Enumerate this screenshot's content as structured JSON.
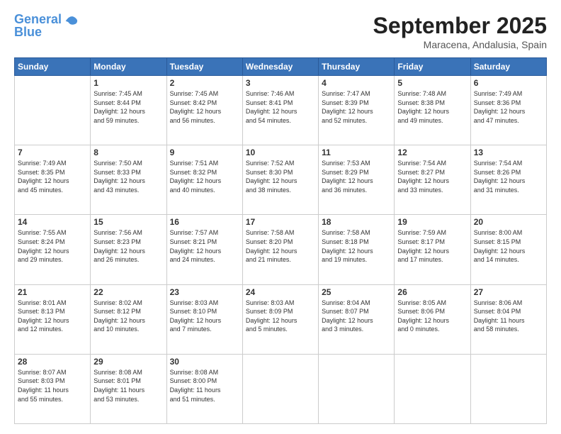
{
  "header": {
    "logo_line1": "General",
    "logo_line2": "Blue",
    "month": "September 2025",
    "location": "Maracena, Andalusia, Spain"
  },
  "weekdays": [
    "Sunday",
    "Monday",
    "Tuesday",
    "Wednesday",
    "Thursday",
    "Friday",
    "Saturday"
  ],
  "weeks": [
    [
      {
        "day": "",
        "info": ""
      },
      {
        "day": "1",
        "info": "Sunrise: 7:45 AM\nSunset: 8:44 PM\nDaylight: 12 hours\nand 59 minutes."
      },
      {
        "day": "2",
        "info": "Sunrise: 7:45 AM\nSunset: 8:42 PM\nDaylight: 12 hours\nand 56 minutes."
      },
      {
        "day": "3",
        "info": "Sunrise: 7:46 AM\nSunset: 8:41 PM\nDaylight: 12 hours\nand 54 minutes."
      },
      {
        "day": "4",
        "info": "Sunrise: 7:47 AM\nSunset: 8:39 PM\nDaylight: 12 hours\nand 52 minutes."
      },
      {
        "day": "5",
        "info": "Sunrise: 7:48 AM\nSunset: 8:38 PM\nDaylight: 12 hours\nand 49 minutes."
      },
      {
        "day": "6",
        "info": "Sunrise: 7:49 AM\nSunset: 8:36 PM\nDaylight: 12 hours\nand 47 minutes."
      }
    ],
    [
      {
        "day": "7",
        "info": "Sunrise: 7:49 AM\nSunset: 8:35 PM\nDaylight: 12 hours\nand 45 minutes."
      },
      {
        "day": "8",
        "info": "Sunrise: 7:50 AM\nSunset: 8:33 PM\nDaylight: 12 hours\nand 43 minutes."
      },
      {
        "day": "9",
        "info": "Sunrise: 7:51 AM\nSunset: 8:32 PM\nDaylight: 12 hours\nand 40 minutes."
      },
      {
        "day": "10",
        "info": "Sunrise: 7:52 AM\nSunset: 8:30 PM\nDaylight: 12 hours\nand 38 minutes."
      },
      {
        "day": "11",
        "info": "Sunrise: 7:53 AM\nSunset: 8:29 PM\nDaylight: 12 hours\nand 36 minutes."
      },
      {
        "day": "12",
        "info": "Sunrise: 7:54 AM\nSunset: 8:27 PM\nDaylight: 12 hours\nand 33 minutes."
      },
      {
        "day": "13",
        "info": "Sunrise: 7:54 AM\nSunset: 8:26 PM\nDaylight: 12 hours\nand 31 minutes."
      }
    ],
    [
      {
        "day": "14",
        "info": "Sunrise: 7:55 AM\nSunset: 8:24 PM\nDaylight: 12 hours\nand 29 minutes."
      },
      {
        "day": "15",
        "info": "Sunrise: 7:56 AM\nSunset: 8:23 PM\nDaylight: 12 hours\nand 26 minutes."
      },
      {
        "day": "16",
        "info": "Sunrise: 7:57 AM\nSunset: 8:21 PM\nDaylight: 12 hours\nand 24 minutes."
      },
      {
        "day": "17",
        "info": "Sunrise: 7:58 AM\nSunset: 8:20 PM\nDaylight: 12 hours\nand 21 minutes."
      },
      {
        "day": "18",
        "info": "Sunrise: 7:58 AM\nSunset: 8:18 PM\nDaylight: 12 hours\nand 19 minutes."
      },
      {
        "day": "19",
        "info": "Sunrise: 7:59 AM\nSunset: 8:17 PM\nDaylight: 12 hours\nand 17 minutes."
      },
      {
        "day": "20",
        "info": "Sunrise: 8:00 AM\nSunset: 8:15 PM\nDaylight: 12 hours\nand 14 minutes."
      }
    ],
    [
      {
        "day": "21",
        "info": "Sunrise: 8:01 AM\nSunset: 8:13 PM\nDaylight: 12 hours\nand 12 minutes."
      },
      {
        "day": "22",
        "info": "Sunrise: 8:02 AM\nSunset: 8:12 PM\nDaylight: 12 hours\nand 10 minutes."
      },
      {
        "day": "23",
        "info": "Sunrise: 8:03 AM\nSunset: 8:10 PM\nDaylight: 12 hours\nand 7 minutes."
      },
      {
        "day": "24",
        "info": "Sunrise: 8:03 AM\nSunset: 8:09 PM\nDaylight: 12 hours\nand 5 minutes."
      },
      {
        "day": "25",
        "info": "Sunrise: 8:04 AM\nSunset: 8:07 PM\nDaylight: 12 hours\nand 3 minutes."
      },
      {
        "day": "26",
        "info": "Sunrise: 8:05 AM\nSunset: 8:06 PM\nDaylight: 12 hours\nand 0 minutes."
      },
      {
        "day": "27",
        "info": "Sunrise: 8:06 AM\nSunset: 8:04 PM\nDaylight: 11 hours\nand 58 minutes."
      }
    ],
    [
      {
        "day": "28",
        "info": "Sunrise: 8:07 AM\nSunset: 8:03 PM\nDaylight: 11 hours\nand 55 minutes."
      },
      {
        "day": "29",
        "info": "Sunrise: 8:08 AM\nSunset: 8:01 PM\nDaylight: 11 hours\nand 53 minutes."
      },
      {
        "day": "30",
        "info": "Sunrise: 8:08 AM\nSunset: 8:00 PM\nDaylight: 11 hours\nand 51 minutes."
      },
      {
        "day": "",
        "info": ""
      },
      {
        "day": "",
        "info": ""
      },
      {
        "day": "",
        "info": ""
      },
      {
        "day": "",
        "info": ""
      }
    ]
  ]
}
